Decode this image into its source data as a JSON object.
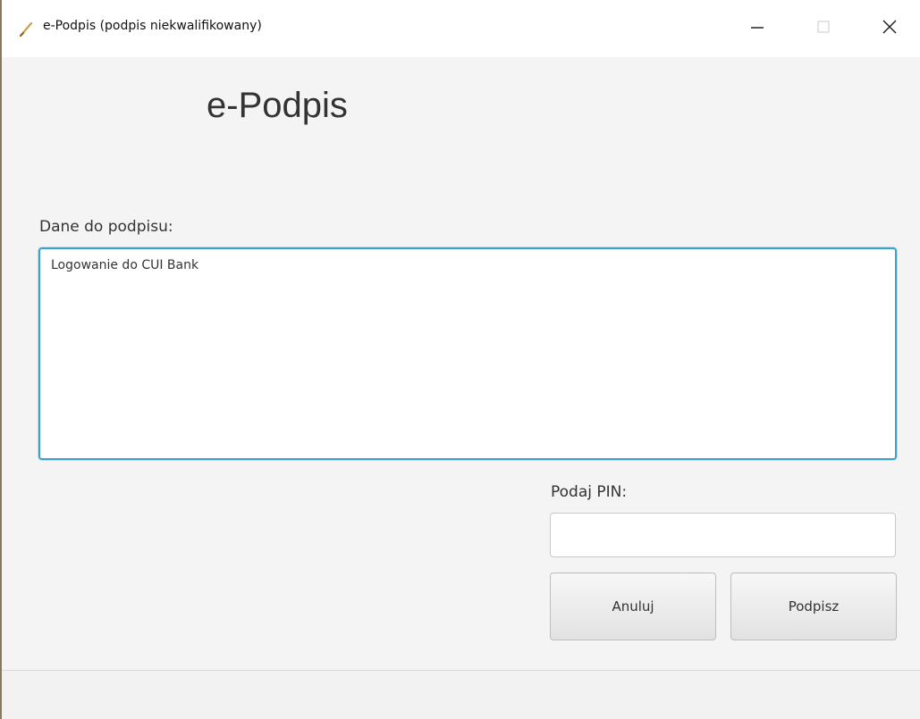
{
  "window": {
    "title": "e-Podpis (podpis niekwalifikowany)",
    "icon": "pen-icon",
    "controls": [
      "minimize-icon",
      "maximize-icon",
      "close-icon"
    ]
  },
  "main": {
    "heading": "e-Podpis",
    "data_label": "Dane do podpisu:",
    "data_value": "Logowanie do CUI Bank",
    "pin_label": "Podaj PIN:",
    "pin_value": "",
    "cancel_label": "Anuluj",
    "sign_label": "Podpisz"
  },
  "colors": {
    "accent": "#3fa0c9",
    "background": "#f4f4f4"
  }
}
